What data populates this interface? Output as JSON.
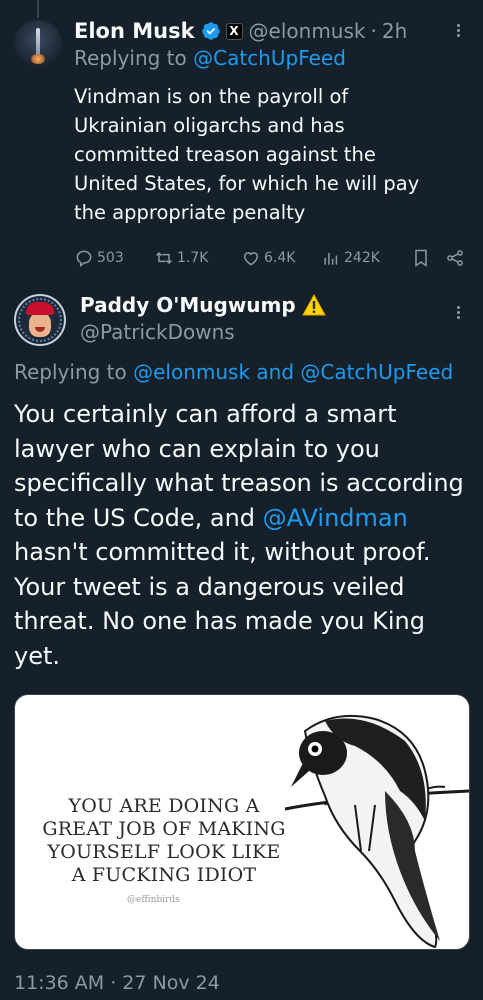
{
  "tweet1": {
    "author_name": "Elon Musk",
    "handle": "@elonmusk",
    "separator": "·",
    "time": "2h",
    "replying_prefix": "Replying to",
    "replying_to": "@CatchUpFeed",
    "text_lines": [
      "Vindman is on the payroll of",
      "Ukrainian oligarchs and has",
      "committed treason against the",
      "United States, for which he will pay",
      "the appropriate penalty"
    ],
    "stats": {
      "replies": "503",
      "reposts": "1.7K",
      "likes": "6.4K",
      "views": "242K"
    },
    "badge_x": "X"
  },
  "tweet2": {
    "author_name": "Paddy O'Mugwump",
    "handle": "@PatrickDowns",
    "replying_prefix": "Replying to",
    "replying_to_1": "@elonmusk",
    "replying_and": "and",
    "replying_to_2": "@CatchUpFeed",
    "text_lines": [
      "You certainly can afford a smart",
      "lawyer who can explain to you",
      "specifically what treason is according",
      "to the US Code, and ",
      "hasn't committed it, without proof.",
      "Your tweet is a dangerous veiled",
      "threat. No one has made you King",
      "yet."
    ],
    "inline_mention": "@AVindman",
    "media": {
      "caption_lines": [
        "YOU ARE DOING A",
        "GREAT JOB OF MAKING",
        "YOURSELF LOOK LIKE",
        "A FUCKING IDIOT"
      ],
      "credit": "@effinbirds"
    },
    "timestamp": "11:36 AM · 27 Nov 24"
  },
  "colors": {
    "background": "#15202b",
    "text": "#f7f9f9",
    "muted": "#8b98a5",
    "accent": "#1d9bf0",
    "warning": "#ffd400"
  },
  "icons": [
    "verified-badge-icon",
    "x-badge-icon",
    "more-icon",
    "reply-icon",
    "repost-icon",
    "like-icon",
    "views-icon",
    "bookmark-icon",
    "share-icon",
    "warning-icon"
  ]
}
